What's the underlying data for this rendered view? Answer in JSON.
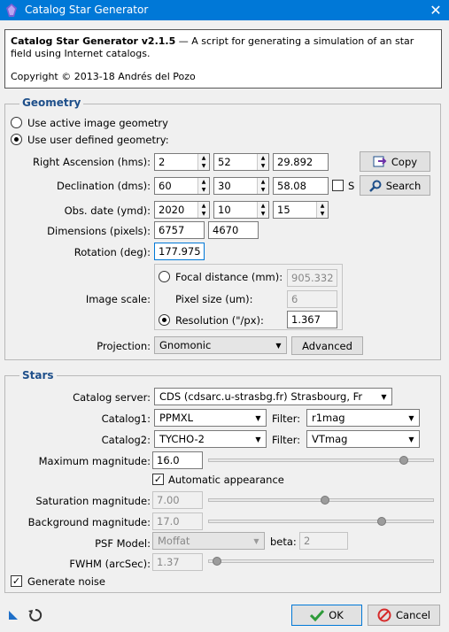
{
  "window": {
    "title": "Catalog Star Generator",
    "close_glyph": "✕"
  },
  "info": {
    "name": "Catalog Star Generator v2.1.5",
    "description": " — A script for generating a simulation of an star field using Internet catalogs.",
    "copyright": "Copyright © 2013-18 Andrés del Pozo"
  },
  "geometry": {
    "title": "Geometry",
    "active_label": "Use active image geometry",
    "user_label": "Use user defined geometry:",
    "ra_label": "Right Ascension (hms):",
    "ra": [
      "2",
      "52",
      "29.892"
    ],
    "dec_label": "Declination (dms):",
    "dec": [
      "60",
      "30",
      "58.08"
    ],
    "south_label": "S",
    "date_label": "Obs. date (ymd):",
    "date": [
      "2020",
      "10",
      "15"
    ],
    "dim_label": "Dimensions (pixels):",
    "dim": [
      "6757",
      "4670"
    ],
    "rot_label": "Rotation (deg):",
    "rot": "177.975",
    "copy_label": "Copy",
    "search_label": "Search",
    "scale_label": "Image scale:",
    "focal_label": "Focal distance (mm):",
    "focal": "905.332",
    "pixel_label": "Pixel size (um):",
    "pixel": "6",
    "res_label": "Resolution (\"/px):",
    "res": "1.367",
    "proj_label": "Projection:",
    "proj": "Gnomonic",
    "advanced_label": "Advanced"
  },
  "stars": {
    "title": "Stars",
    "server_label": "Catalog server:",
    "server": "CDS (cdsarc.u-strasbg.fr) Strasbourg, Fr",
    "cat1_label": "Catalog1:",
    "cat1": "PPMXL",
    "filter_label": "Filter:",
    "filter1": "r1mag",
    "cat2_label": "Catalog2:",
    "cat2": "TYCHO-2",
    "filter2": "VTmag",
    "maxmag_label": "Maximum magnitude:",
    "maxmag": "16.0",
    "maxmag_level": 0.88,
    "auto_label": "Automatic appearance",
    "sat_label": "Saturation magnitude:",
    "sat": "7.00",
    "sat_level": 0.52,
    "bg_label": "Background magnitude:",
    "bg": "17.0",
    "bg_level": 0.78,
    "psf_label": "PSF Model:",
    "psf": "Moffat",
    "beta_label": "beta:",
    "beta": "2",
    "fwhm_label": "FWHM (arcSec):",
    "fwhm": "1.37",
    "fwhm_level": 0.02,
    "noise_label": "Generate noise"
  },
  "footer": {
    "ok_label": "OK",
    "cancel_label": "Cancel"
  },
  "colors": {
    "titlebar": "#0078d7",
    "group_title": "#1e4f8a",
    "ok_check": "#2e9b3a",
    "cancel_icon": "#d62b2b"
  }
}
